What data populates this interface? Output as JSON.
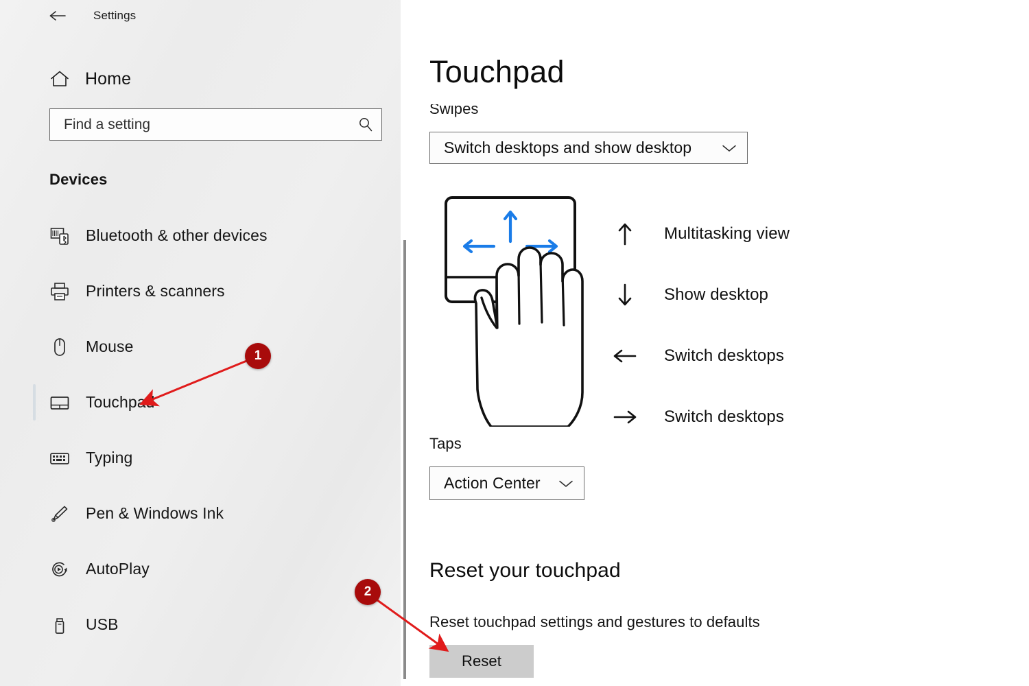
{
  "window": {
    "app_title": "Settings",
    "back_icon": "back-arrow-icon"
  },
  "sidebar": {
    "home_label": "Home",
    "home_icon": "home-icon",
    "search": {
      "placeholder": "Find a setting",
      "value": "",
      "icon": "search-icon"
    },
    "group_title": "Devices",
    "items": [
      {
        "label": "Bluetooth & other devices",
        "icon": "bluetooth-devices-icon",
        "selected": false
      },
      {
        "label": "Printers & scanners",
        "icon": "printer-icon",
        "selected": false
      },
      {
        "label": "Mouse",
        "icon": "mouse-icon",
        "selected": false
      },
      {
        "label": "Touchpad",
        "icon": "touchpad-icon",
        "selected": true
      },
      {
        "label": "Typing",
        "icon": "keyboard-icon",
        "selected": false
      },
      {
        "label": "Pen & Windows Ink",
        "icon": "pen-icon",
        "selected": false
      },
      {
        "label": "AutoPlay",
        "icon": "autoplay-icon",
        "selected": false
      },
      {
        "label": "USB",
        "icon": "usb-icon",
        "selected": false
      }
    ]
  },
  "main": {
    "page_title": "Touchpad",
    "swipes": {
      "label": "Swipes",
      "selected_value": "Switch desktops and show desktop",
      "chevron_icon": "chevron-down-icon"
    },
    "gesture_illustration": {
      "name": "four-finger-swipe-illustration",
      "arrow_color": "#1a7ce8",
      "outline_color": "#111111"
    },
    "legend": [
      {
        "arrow": "arrow-up-icon",
        "glyph": "↑",
        "text": "Multitasking view"
      },
      {
        "arrow": "arrow-down-icon",
        "glyph": "↓",
        "text": "Show desktop"
      },
      {
        "arrow": "arrow-left-icon",
        "glyph": "←",
        "text": "Switch desktops"
      },
      {
        "arrow": "arrow-right-icon",
        "glyph": "→",
        "text": "Switch desktops"
      }
    ],
    "taps": {
      "label": "Taps",
      "selected_value": "Action Center",
      "chevron_icon": "chevron-down-icon"
    },
    "reset": {
      "heading": "Reset your touchpad",
      "description": "Reset touchpad settings and gestures to defaults",
      "button_label": "Reset"
    }
  },
  "annotations": {
    "badge_color": "#a80b0b",
    "arrow_color": "#e01b1b",
    "markers": [
      {
        "number": "1",
        "points_to": "sidebar-item-touchpad"
      },
      {
        "number": "2",
        "points_to": "reset-button"
      }
    ]
  }
}
